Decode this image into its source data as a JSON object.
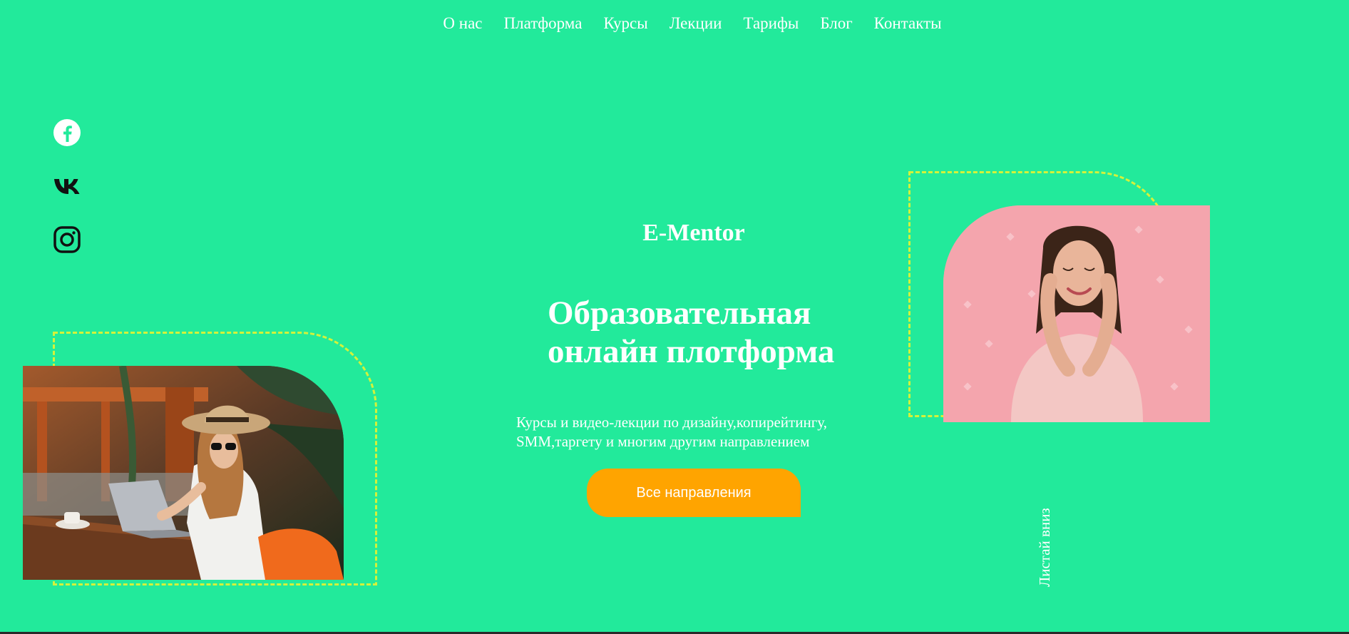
{
  "nav": {
    "items": [
      "О нас",
      "Платформа",
      "Курсы",
      "Лекции",
      "Тарифы",
      "Блог",
      "Контакты"
    ]
  },
  "social": {
    "icons": [
      "facebook-icon",
      "vk-icon",
      "instagram-icon"
    ]
  },
  "hero": {
    "brand": "E-Mentor",
    "headline_line1": "Образовательная",
    "headline_line2": "онлайн плотформа",
    "subtitle_line1": "Курсы и видео-лекции по дизайну,копирейтингу,",
    "subtitle_line2": "SMM,таргету и многим другим направлением",
    "cta_label": "Все направления",
    "scroll_hint": "Листай вниз"
  },
  "colors": {
    "background": "#22ea9b",
    "accent_button": "#ffa400",
    "dashed_frame": "#d4f23a",
    "text": "#ffffff"
  }
}
